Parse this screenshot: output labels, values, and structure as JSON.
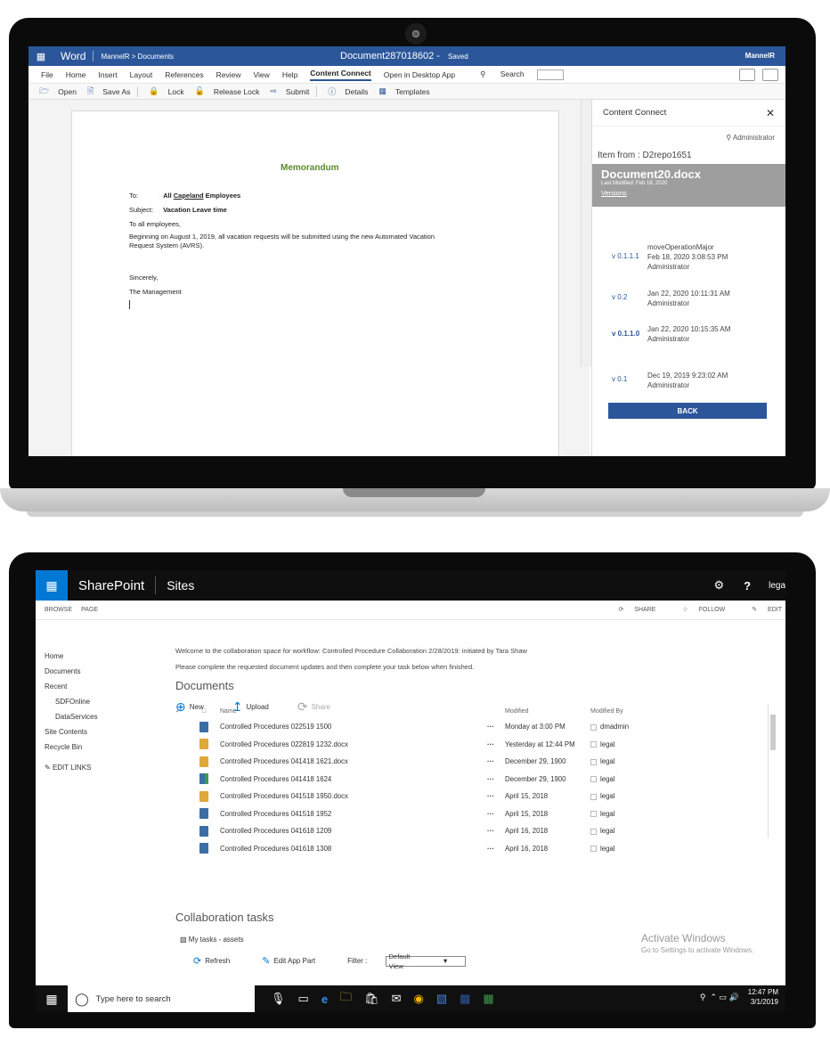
{
  "word": {
    "app": "Word",
    "breadcrumb": "MannelR > Documents",
    "doc_title": "Document287018602",
    "saved": "Saved",
    "user": "MannelR",
    "menu": [
      "File",
      "Home",
      "Insert",
      "Layout",
      "References",
      "Review",
      "View",
      "Help",
      "Content Connect",
      "Open in Desktop App"
    ],
    "active_menu": "Content Connect",
    "search": "Search",
    "toolbar": {
      "open": "Open",
      "save_as": "Save As",
      "lock": "Lock",
      "release_lock": "Release Lock",
      "submit": "Submit",
      "details": "Details",
      "templates": "Templates"
    },
    "memo": {
      "title": "Memorandum",
      "to_label": "To:",
      "to_pre": "All ",
      "to_org": "Capeland",
      "to_post": " Employees",
      "subject_label": "Subject:",
      "subject": "Vacation Leave time",
      "greeting": "To all employees,",
      "body_1": "Beginning on August 1, 2019, all vacation requests will be submitted using the new Automated Vacation",
      "body_2": "Request System (AVRS).",
      "closing": "Sincerely,",
      "signature": "The Management"
    },
    "panel": {
      "title": "Content Connect",
      "admin": "Administrator",
      "from": "Item from : D2repo1651",
      "doc_name": "Document20.docx",
      "last_modified": "Last Modified: Feb 18, 2020",
      "versions": "Versions",
      "entries": [
        {
          "ver": "v 0.1.1.1",
          "line1": "moveOperationMajor",
          "line2": "Feb 18, 2020 3:08:53 PM",
          "line3": "Administrator"
        },
        {
          "ver": "v 0.2",
          "line1": "Jan 22, 2020 10:11:31 AM",
          "line2": "Administrator",
          "line3": ""
        },
        {
          "ver": "v 0.1.1.0",
          "line1": "Jan 22, 2020 10:15:35 AM",
          "line2": "Administrator",
          "line3": ""
        },
        {
          "ver": "v 0.1",
          "line1": "Dec 19, 2019 9:23:02 AM",
          "line2": "Administrator",
          "line3": ""
        }
      ],
      "back": "BACK"
    }
  },
  "sharepoint": {
    "brand": "SharePoint",
    "section": "Sites",
    "user": "lega",
    "ribbon": {
      "browse": "BROWSE",
      "page": "PAGE",
      "share": "SHARE",
      "follow": "FOLLOW",
      "edit": "EDIT"
    },
    "nav": [
      "Home",
      "Documents",
      "Recent",
      "SDFOnline",
      "DataServices",
      "Site Contents",
      "Recycle Bin"
    ],
    "edit_links": "EDIT LINKS",
    "welcome_1": "Welcome to the collaboration space for workflow: Controlled Procedure Collaboration 2/28/2019: initiated by Tara Shaw",
    "welcome_2": "Please complete the requested document updates and then complete your task below when finished.",
    "documents_heading": "Documents",
    "actions": {
      "new": "New",
      "upload": "Upload",
      "share": "Share"
    },
    "columns": {
      "name": "Name",
      "modified": "Modified",
      "modified_by": "Modified By"
    },
    "rows": [
      {
        "name": "Controlled Procedures 022519 1500",
        "modified": "Monday at 3:00 PM",
        "by": "dmadmin",
        "icon": "blue"
      },
      {
        "name": "Controlled Procedures 022819 1232.docx",
        "modified": "Yesterday at 12:44 PM",
        "by": "legal",
        "icon": "gold"
      },
      {
        "name": "Controlled Procedures 041418 1621.docx",
        "modified": "December 29, 1900",
        "by": "legal",
        "icon": "gold"
      },
      {
        "name": "Controlled Procedures 041418 1624",
        "modified": "December 29, 1900",
        "by": "legal",
        "icon": "green"
      },
      {
        "name": "Controlled Procedures 041518 1950.docx",
        "modified": "April 15, 2018",
        "by": "legal",
        "icon": "gold"
      },
      {
        "name": "Controlled Procedures 041518 1952",
        "modified": "April 15, 2018",
        "by": "legal",
        "icon": "blue"
      },
      {
        "name": "Controlled Procedures 041618 1209",
        "modified": "April 16, 2018",
        "by": "legal",
        "icon": "blue"
      },
      {
        "name": "Controlled Procedures 041618 1308",
        "modified": "April 16, 2018",
        "by": "legal",
        "icon": "blue"
      }
    ],
    "collab_heading": "Collaboration tasks",
    "my_tasks": "My tasks - assets",
    "refresh": "Refresh",
    "edit_app_part": "Edit App Part",
    "filter_label": "Filter :",
    "filter_value": "Default View",
    "activate_1": "Activate Windows",
    "activate_2": "Go to Settings to activate Windows.",
    "taskbar": {
      "search": "Type here to search",
      "time": "12:47 PM",
      "date": "3/1/2019"
    }
  }
}
